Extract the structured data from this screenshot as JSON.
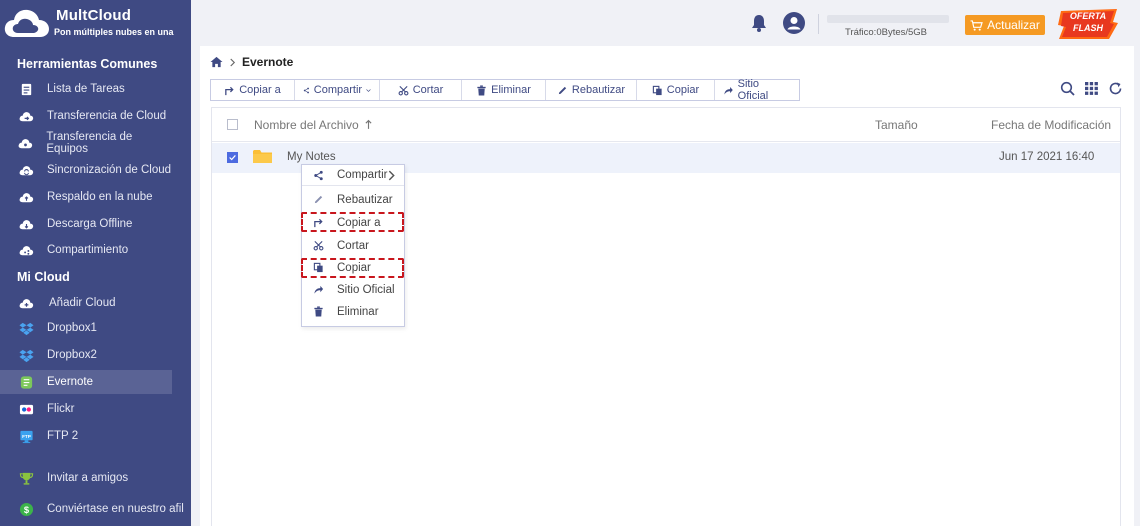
{
  "brand": {
    "name": "MultCloud",
    "tagline": "Pon múltiples nubes en una"
  },
  "sidebar": {
    "section_tools": "Herramientas Comunes",
    "tools": [
      {
        "label": "Lista de Tareas",
        "icon": "task-list-icon"
      },
      {
        "label": "Transferencia de Cloud",
        "icon": "cloud-transfer-icon"
      },
      {
        "label": "Transferencia de Equipos",
        "icon": "team-transfer-icon"
      },
      {
        "label": "Sincronización de Cloud",
        "icon": "cloud-sync-icon"
      },
      {
        "label": "Respaldo en la nube",
        "icon": "cloud-backup-icon"
      },
      {
        "label": "Descarga Offline",
        "icon": "offline-download-icon"
      },
      {
        "label": "Compartimiento",
        "icon": "share-cloud-icon"
      }
    ],
    "section_mycloud": "Mi Cloud",
    "clouds": [
      {
        "label": "Añadir Cloud",
        "icon": "add-cloud-icon"
      },
      {
        "label": "Dropbox1",
        "icon": "dropbox-icon"
      },
      {
        "label": "Dropbox2",
        "icon": "dropbox-icon"
      },
      {
        "label": "Evernote",
        "icon": "evernote-icon",
        "active": true
      },
      {
        "label": "Flickr",
        "icon": "flickr-icon"
      },
      {
        "label": "FTP 2",
        "icon": "ftp-icon"
      }
    ],
    "extras": [
      {
        "label": "Invitar a amigos",
        "icon": "trophy-icon"
      },
      {
        "label": "Conviértase en nuestro afil",
        "icon": "dollar-icon"
      }
    ]
  },
  "header": {
    "traffic": "Tráfico:0Bytes/5GB",
    "upgrade_label": "Actualizar",
    "flash_line1": "OFERTA",
    "flash_line2": "FLASH"
  },
  "breadcrumb": {
    "current": "Evernote"
  },
  "toolbar": {
    "copy_to": "Copiar a",
    "share": "Compartir",
    "cut": "Cortar",
    "delete": "Eliminar",
    "rename": "Rebautizar",
    "copy": "Copiar",
    "official_site": "Sitio Oficial"
  },
  "table": {
    "col_name": "Nombre del Archivo",
    "col_size": "Tamaño",
    "col_date": "Fecha de Modificación",
    "rows": [
      {
        "name": "My Notes",
        "size": "",
        "date": "Jun 17 2021 16:40",
        "selected": true
      }
    ]
  },
  "context_menu": {
    "items": [
      {
        "label": "Compartir",
        "icon": "share-icon"
      },
      {
        "label": "Rebautizar",
        "icon": "pencil-icon"
      },
      {
        "label": "Copiar a",
        "icon": "copy-to-icon"
      },
      {
        "label": "Cortar",
        "icon": "scissors-icon"
      },
      {
        "label": "Copiar",
        "icon": "copy-icon"
      },
      {
        "label": "Sitio Oficial",
        "icon": "official-site-icon"
      },
      {
        "label": "Eliminar",
        "icon": "trash-icon"
      }
    ]
  },
  "colors": {
    "sidebar_bg": "#3f4a83",
    "accent": "#3f4a83",
    "upgrade": "#f59a23",
    "highlight": "#c8161d"
  }
}
